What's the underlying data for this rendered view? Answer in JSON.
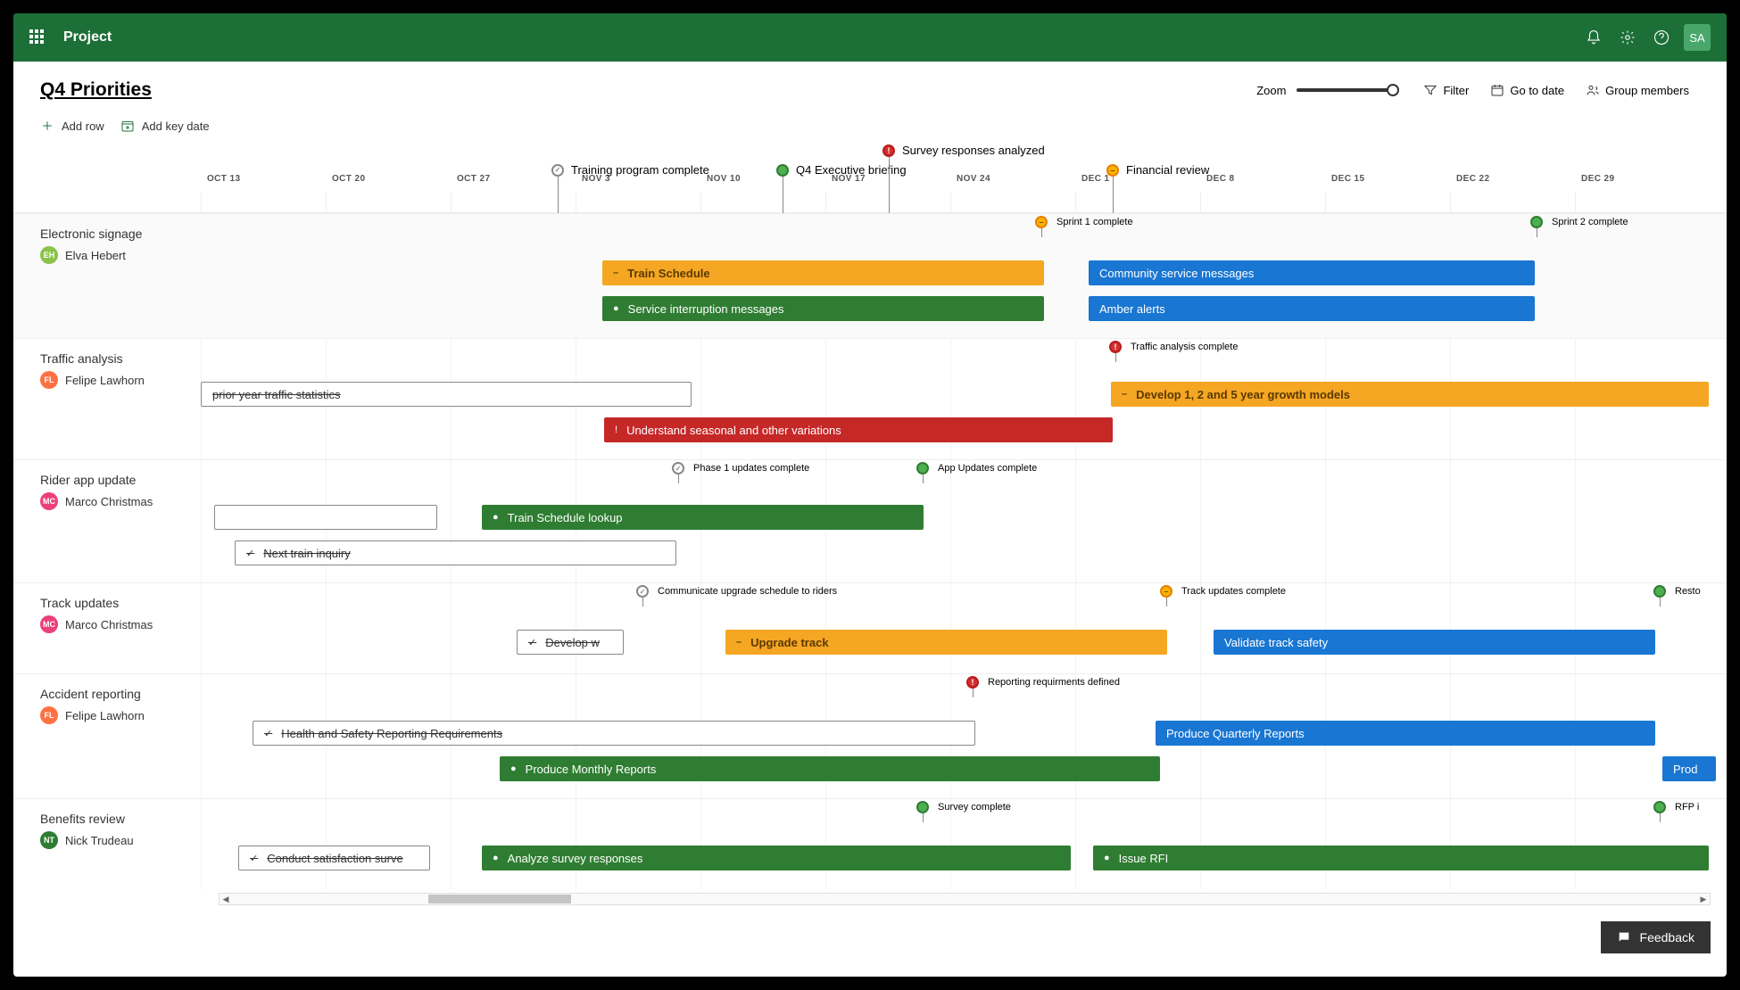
{
  "app": "Project",
  "user_avatar": "SA",
  "project_title": "Q4 Priorities",
  "header_buttons": {
    "zoom": "Zoom",
    "filter": "Filter",
    "goto": "Go to date",
    "members": "Group members"
  },
  "toolbar": {
    "add_row": "Add row",
    "add_key_date": "Add key date"
  },
  "date_columns": [
    "OCT 13",
    "OCT 20",
    "OCT 27",
    "NOV 3",
    "NOV 10",
    "NOV 17",
    "NOV 24",
    "DEC 1",
    "DEC 8",
    "DEC 15",
    "DEC 22",
    "DEC 29"
  ],
  "top_milestones": [
    {
      "label": "Training program complete",
      "color": "open"
    },
    {
      "label": "Q4 Executive briefing",
      "color": "green"
    },
    {
      "label": "Survey responses analyzed",
      "color": "red"
    },
    {
      "label": "Financial review",
      "color": "orange"
    }
  ],
  "lanes": {
    "electronic": {
      "title": "Electronic signage",
      "person": "Elva Hebert",
      "initials": "EH",
      "milestones": [
        {
          "label": "Sprint 1 complete",
          "color": "orange"
        },
        {
          "label": "Sprint 2 complete",
          "color": "green"
        }
      ],
      "bars": [
        {
          "label": "Train Schedule",
          "color": "orange",
          "icon": "–"
        },
        {
          "label": "Community service messages",
          "color": "blue",
          "icon": ""
        },
        {
          "label": "Service interruption messages",
          "color": "green",
          "icon": "●"
        },
        {
          "label": "Amber alerts",
          "color": "blue",
          "icon": ""
        }
      ]
    },
    "traffic": {
      "title": "Traffic analysis",
      "person": "Felipe Lawhorn",
      "initials": "FL",
      "milestones": [
        {
          "label": "Traffic analysis complete",
          "color": "red"
        }
      ],
      "bars": [
        {
          "label": "prior year traffic statistics",
          "color": "done",
          "icon": ""
        },
        {
          "label": "Develop 1, 2 and 5 year growth models",
          "color": "orange",
          "icon": "–"
        },
        {
          "label": "Understand seasonal and other variations",
          "color": "red",
          "icon": "!"
        }
      ]
    },
    "rider": {
      "title": "Rider app update",
      "person": "Marco Christmas",
      "initials": "MC",
      "milestones": [
        {
          "label": "Phase 1 updates complete",
          "color": "open"
        },
        {
          "label": "App Updates complete",
          "color": "green"
        }
      ],
      "bars": [
        {
          "label": "",
          "color": "done",
          "icon": ""
        },
        {
          "label": "Train Schedule lookup",
          "color": "green",
          "icon": "●"
        },
        {
          "label": "Next train inquiry",
          "color": "done",
          "icon": "✓"
        }
      ]
    },
    "track": {
      "title": "Track updates",
      "person": "Marco Christmas",
      "initials": "MC",
      "milestones": [
        {
          "label": "Communicate upgrade schedule to riders",
          "color": "open"
        },
        {
          "label": "Track updates complete",
          "color": "orange"
        },
        {
          "label": "Resto",
          "color": "green"
        }
      ],
      "bars": [
        {
          "label": "Develop w",
          "color": "done",
          "icon": "✓"
        },
        {
          "label": "Upgrade track",
          "color": "orange",
          "icon": "–"
        },
        {
          "label": "Validate track safety",
          "color": "blue",
          "icon": ""
        }
      ]
    },
    "accident": {
      "title": "Accident reporting",
      "person": "Felipe Lawhorn",
      "initials": "FL",
      "milestones": [
        {
          "label": "Reporting requirments defined",
          "color": "red"
        }
      ],
      "bars": [
        {
          "label": "Health and Safety Reporting Requirements",
          "color": "done",
          "icon": "✓"
        },
        {
          "label": "Produce Quarterly Reports",
          "color": "blue",
          "icon": ""
        },
        {
          "label": "Produce Monthly Reports",
          "color": "green",
          "icon": "●"
        },
        {
          "label": "Prod",
          "color": "blue",
          "icon": ""
        }
      ]
    },
    "benefits": {
      "title": "Benefits review",
      "person": "Nick Trudeau",
      "initials": "NT",
      "milestones": [
        {
          "label": "Survey complete",
          "color": "green"
        },
        {
          "label": "RFP i",
          "color": "green"
        }
      ],
      "bars": [
        {
          "label": "Conduct satisfaction surve",
          "color": "done",
          "icon": "✓"
        },
        {
          "label": "Analyze survey responses",
          "color": "green",
          "icon": "●"
        },
        {
          "label": "Issue RFI",
          "color": "green",
          "icon": "●"
        }
      ]
    }
  },
  "feedback": "Feedback"
}
